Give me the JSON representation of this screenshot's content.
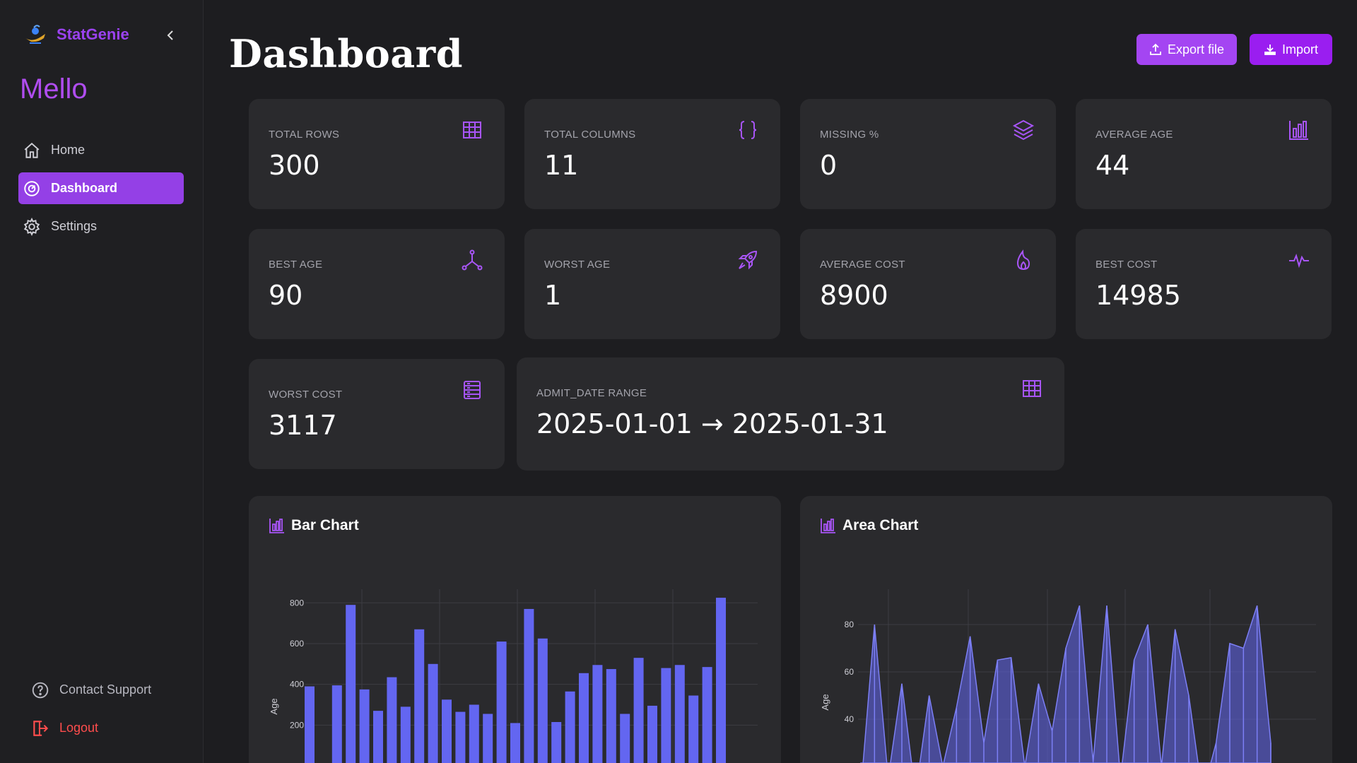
{
  "app": {
    "brand": "StatGenie",
    "user": "Mello"
  },
  "nav": {
    "home": "Home",
    "dashboard": "Dashboard",
    "settings": "Settings",
    "support": "Contact Support",
    "logout": "Logout"
  },
  "header": {
    "title": "Dashboard",
    "export_label": "Export file",
    "import_label": "Import"
  },
  "stats": [
    {
      "label": "TOTAL ROWS",
      "value": "300",
      "icon": "table-icon"
    },
    {
      "label": "TOTAL COLUMNS",
      "value": "11",
      "icon": "braces-icon"
    },
    {
      "label": "MISSING %",
      "value": "0",
      "icon": "layers-icon"
    },
    {
      "label": "AVERAGE AGE",
      "value": "44",
      "icon": "bar-chart-icon"
    },
    {
      "label": "BEST AGE",
      "value": "90",
      "icon": "network-icon"
    },
    {
      "label": "WORST AGE",
      "value": "1",
      "icon": "rocket-icon"
    },
    {
      "label": "AVERAGE COST",
      "value": "8900",
      "icon": "flame-icon"
    },
    {
      "label": "BEST COST",
      "value": "14985",
      "icon": "pulse-icon"
    },
    {
      "label": "WORST COST",
      "value": "3117",
      "icon": "rows-icon"
    },
    {
      "label": "ADMIT_DATE RANGE",
      "value": "2025-01-01 → 2025-01-31",
      "icon": "table-icon"
    }
  ],
  "colors": {
    "accent": "#9b42f0",
    "bar": "#6366f1",
    "card": "#2a2a2d",
    "logout": "#ff4d4d"
  },
  "chart_data": [
    {
      "type": "bar",
      "title": "Bar Chart",
      "ylabel": "Age",
      "yticks": [
        200,
        400,
        600,
        800
      ],
      "ylim": [
        0,
        860
      ],
      "values": [
        390,
        0,
        395,
        790,
        375,
        270,
        435,
        290,
        670,
        500,
        325,
        265,
        300,
        255,
        610,
        210,
        770,
        625,
        215,
        365,
        455,
        495,
        475,
        255,
        530,
        295,
        480,
        495,
        345,
        485,
        825
      ],
      "grid": true
    },
    {
      "type": "area",
      "title": "Area Chart",
      "ylabel": "Age",
      "yticks": [
        40,
        60,
        80
      ],
      "ylim": [
        20,
        95
      ],
      "values": [
        10,
        80,
        15,
        55,
        8,
        50,
        20,
        45,
        75,
        30,
        65,
        66,
        20,
        55,
        35,
        70,
        88,
        22,
        88,
        15,
        65,
        80,
        20,
        78,
        50,
        8,
        30,
        72,
        70,
        88,
        30
      ]
    }
  ]
}
